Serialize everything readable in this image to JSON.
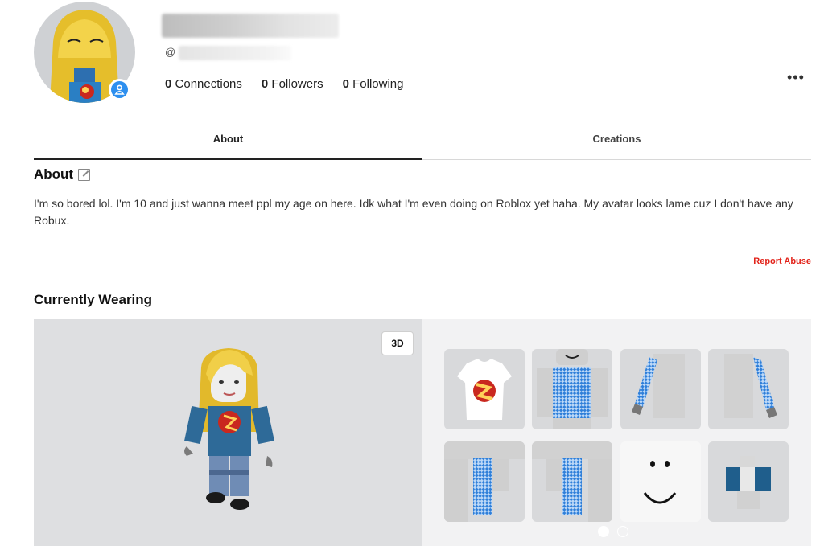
{
  "profile": {
    "handle_prefix": "@",
    "stats": [
      {
        "count": "0",
        "label": "Connections"
      },
      {
        "count": "0",
        "label": "Followers"
      },
      {
        "count": "0",
        "label": "Following"
      }
    ],
    "more_icon": "ellipsis-icon",
    "badge_icon": "person-icon"
  },
  "tabs": [
    {
      "label": "About",
      "active": true
    },
    {
      "label": "Creations",
      "active": false
    }
  ],
  "about": {
    "title": "About",
    "text": "I'm so bored lol. I'm 10 and just wanna meet ppl my age on here. Idk what I'm even doing on Roblox yet haha. My avatar looks lame cuz I don't have any Robux.",
    "report_label": "Report Abuse"
  },
  "wearing": {
    "title": "Currently Wearing",
    "toggle_label": "3D",
    "items": [
      "tshirt-item",
      "shirt-item",
      "right-arm-item",
      "left-arm-item",
      "left-leg-item",
      "right-leg-item",
      "face-item",
      "torso-item"
    ],
    "page_count": 2,
    "current_page": 1
  },
  "colors": {
    "accent_blue": "#2d8fef",
    "report_red": "#e2231a",
    "preview_bg": "#dedfe1"
  }
}
